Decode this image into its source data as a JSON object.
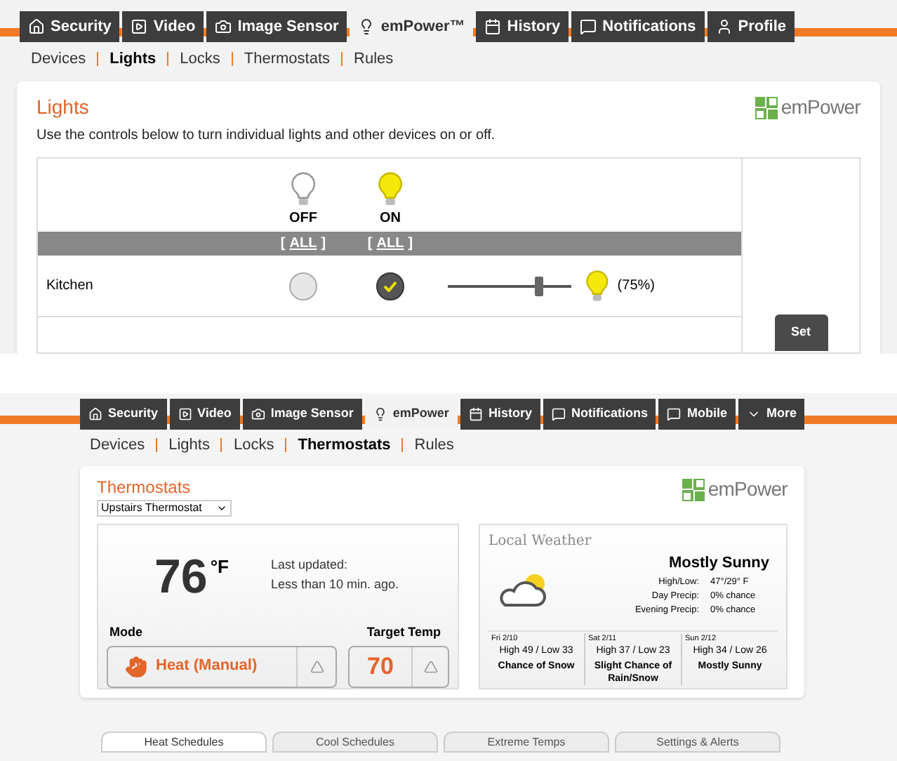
{
  "lights_screen": {
    "nav_tabs": [
      {
        "label": "Security",
        "selected": false
      },
      {
        "label": "Video",
        "selected": false
      },
      {
        "label": "Image Sensor",
        "selected": false
      },
      {
        "label": "emPower™",
        "selected": true
      },
      {
        "label": "History",
        "selected": false
      },
      {
        "label": "Notifications",
        "selected": false
      },
      {
        "label": "Profile",
        "selected": false
      }
    ],
    "sub_nav": [
      {
        "label": "Devices",
        "selected": false
      },
      {
        "label": "Lights",
        "selected": true
      },
      {
        "label": "Locks",
        "selected": false
      },
      {
        "label": "Thermostats",
        "selected": false
      },
      {
        "label": "Rules",
        "selected": false
      }
    ],
    "title": "Lights",
    "logo": "emPower",
    "description": "Use the controls below to turn individual lights and other devices on or off.",
    "columns": [
      {
        "label": "OFF",
        "kind": "off",
        "all": {
          "before": "[",
          "link": "ALL",
          "after": "]"
        }
      },
      {
        "label": "ON",
        "kind": "on",
        "all": {
          "before": "[",
          "link": "ALL",
          "after": "]"
        }
      }
    ],
    "devices": [
      {
        "name": "Kitchen",
        "on": true,
        "level": 0.75,
        "reading": "(75%)"
      }
    ],
    "set_button": "Set"
  },
  "thermostat_screen": {
    "nav_tabs": [
      {
        "label": "Security",
        "selected": false
      },
      {
        "label": "Video",
        "selected": false
      },
      {
        "label": "Image Sensor",
        "selected": false
      },
      {
        "label": "emPower",
        "selected": true
      },
      {
        "label": "History",
        "selected": false
      },
      {
        "label": "Notifications",
        "selected": false
      },
      {
        "label": "Mobile",
        "selected": false
      },
      {
        "label": "More",
        "selected": false
      }
    ],
    "sub_nav": [
      {
        "label": "Devices",
        "selected": false
      },
      {
        "label": "Lights",
        "selected": false
      },
      {
        "label": "Locks",
        "selected": false
      },
      {
        "label": "Thermostats",
        "selected": true
      },
      {
        "label": "Rules",
        "selected": false
      }
    ],
    "title": "Thermostats",
    "logo": "emPower",
    "thermostat_select": "Upstairs Thermostat",
    "temperature": "76",
    "unit": "°F",
    "last_updated": "Last updated:",
    "last_updated_value": "Less than 10 min. ago.",
    "mode_label": "Mode",
    "mode": "Heat (Manual)",
    "target_label": "Target Temp",
    "target": "70",
    "weather": {
      "title": "Local Weather",
      "condition": "Mostly Sunny",
      "details": [
        {
          "label": "High/Low:",
          "value": "47°/29° F"
        },
        {
          "label": "Day Precip:",
          "value": "0% chance"
        },
        {
          "label": "Evening Precip:",
          "value": "0% chance"
        }
      ],
      "forecast": [
        {
          "date": "Fri 2/10",
          "temps": "High 49 / Low 33",
          "summary": "Chance of Snow"
        },
        {
          "date": "Sat 2/11",
          "temps": "High 37 / Low 23",
          "summary": "Slight Chance of Rain/Snow"
        },
        {
          "date": "Sun 2/12",
          "temps": "High 34 / Low 26",
          "summary": "Mostly Sunny"
        }
      ]
    },
    "tabs": [
      {
        "label": "Heat Schedules",
        "selected": true
      },
      {
        "label": "Cool Schedules",
        "selected": false
      },
      {
        "label": "Extreme Temps",
        "selected": false
      },
      {
        "label": "Settings & Alerts",
        "selected": false
      }
    ]
  }
}
